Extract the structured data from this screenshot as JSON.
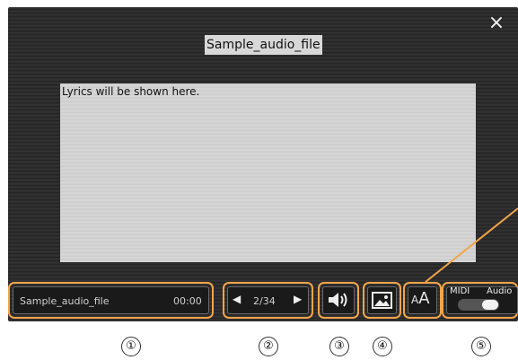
{
  "header": {
    "song_title": "Sample_audio_file",
    "close_label": "×"
  },
  "lyrics": {
    "text": "Lyrics will be shown here."
  },
  "controls": {
    "file": {
      "name": "Sample_audio_file",
      "time": "00:00"
    },
    "page": {
      "prev": "◀",
      "current": "2/34",
      "next": "▶"
    },
    "volume": {
      "icon": "speaker-icon"
    },
    "image": {
      "icon": "picture-icon"
    },
    "font": {
      "label": "AA",
      "icon": "font-size-icon"
    },
    "mode": {
      "midi_label": "MIDI",
      "audio_label": "Audio",
      "selected": "Audio"
    }
  },
  "callouts": [
    "①",
    "②",
    "③",
    "④",
    "⑤"
  ],
  "colors": {
    "accent": "#f2a54a",
    "background": "#2e2e2e",
    "lyrics_bg": "#d2d2d2"
  }
}
